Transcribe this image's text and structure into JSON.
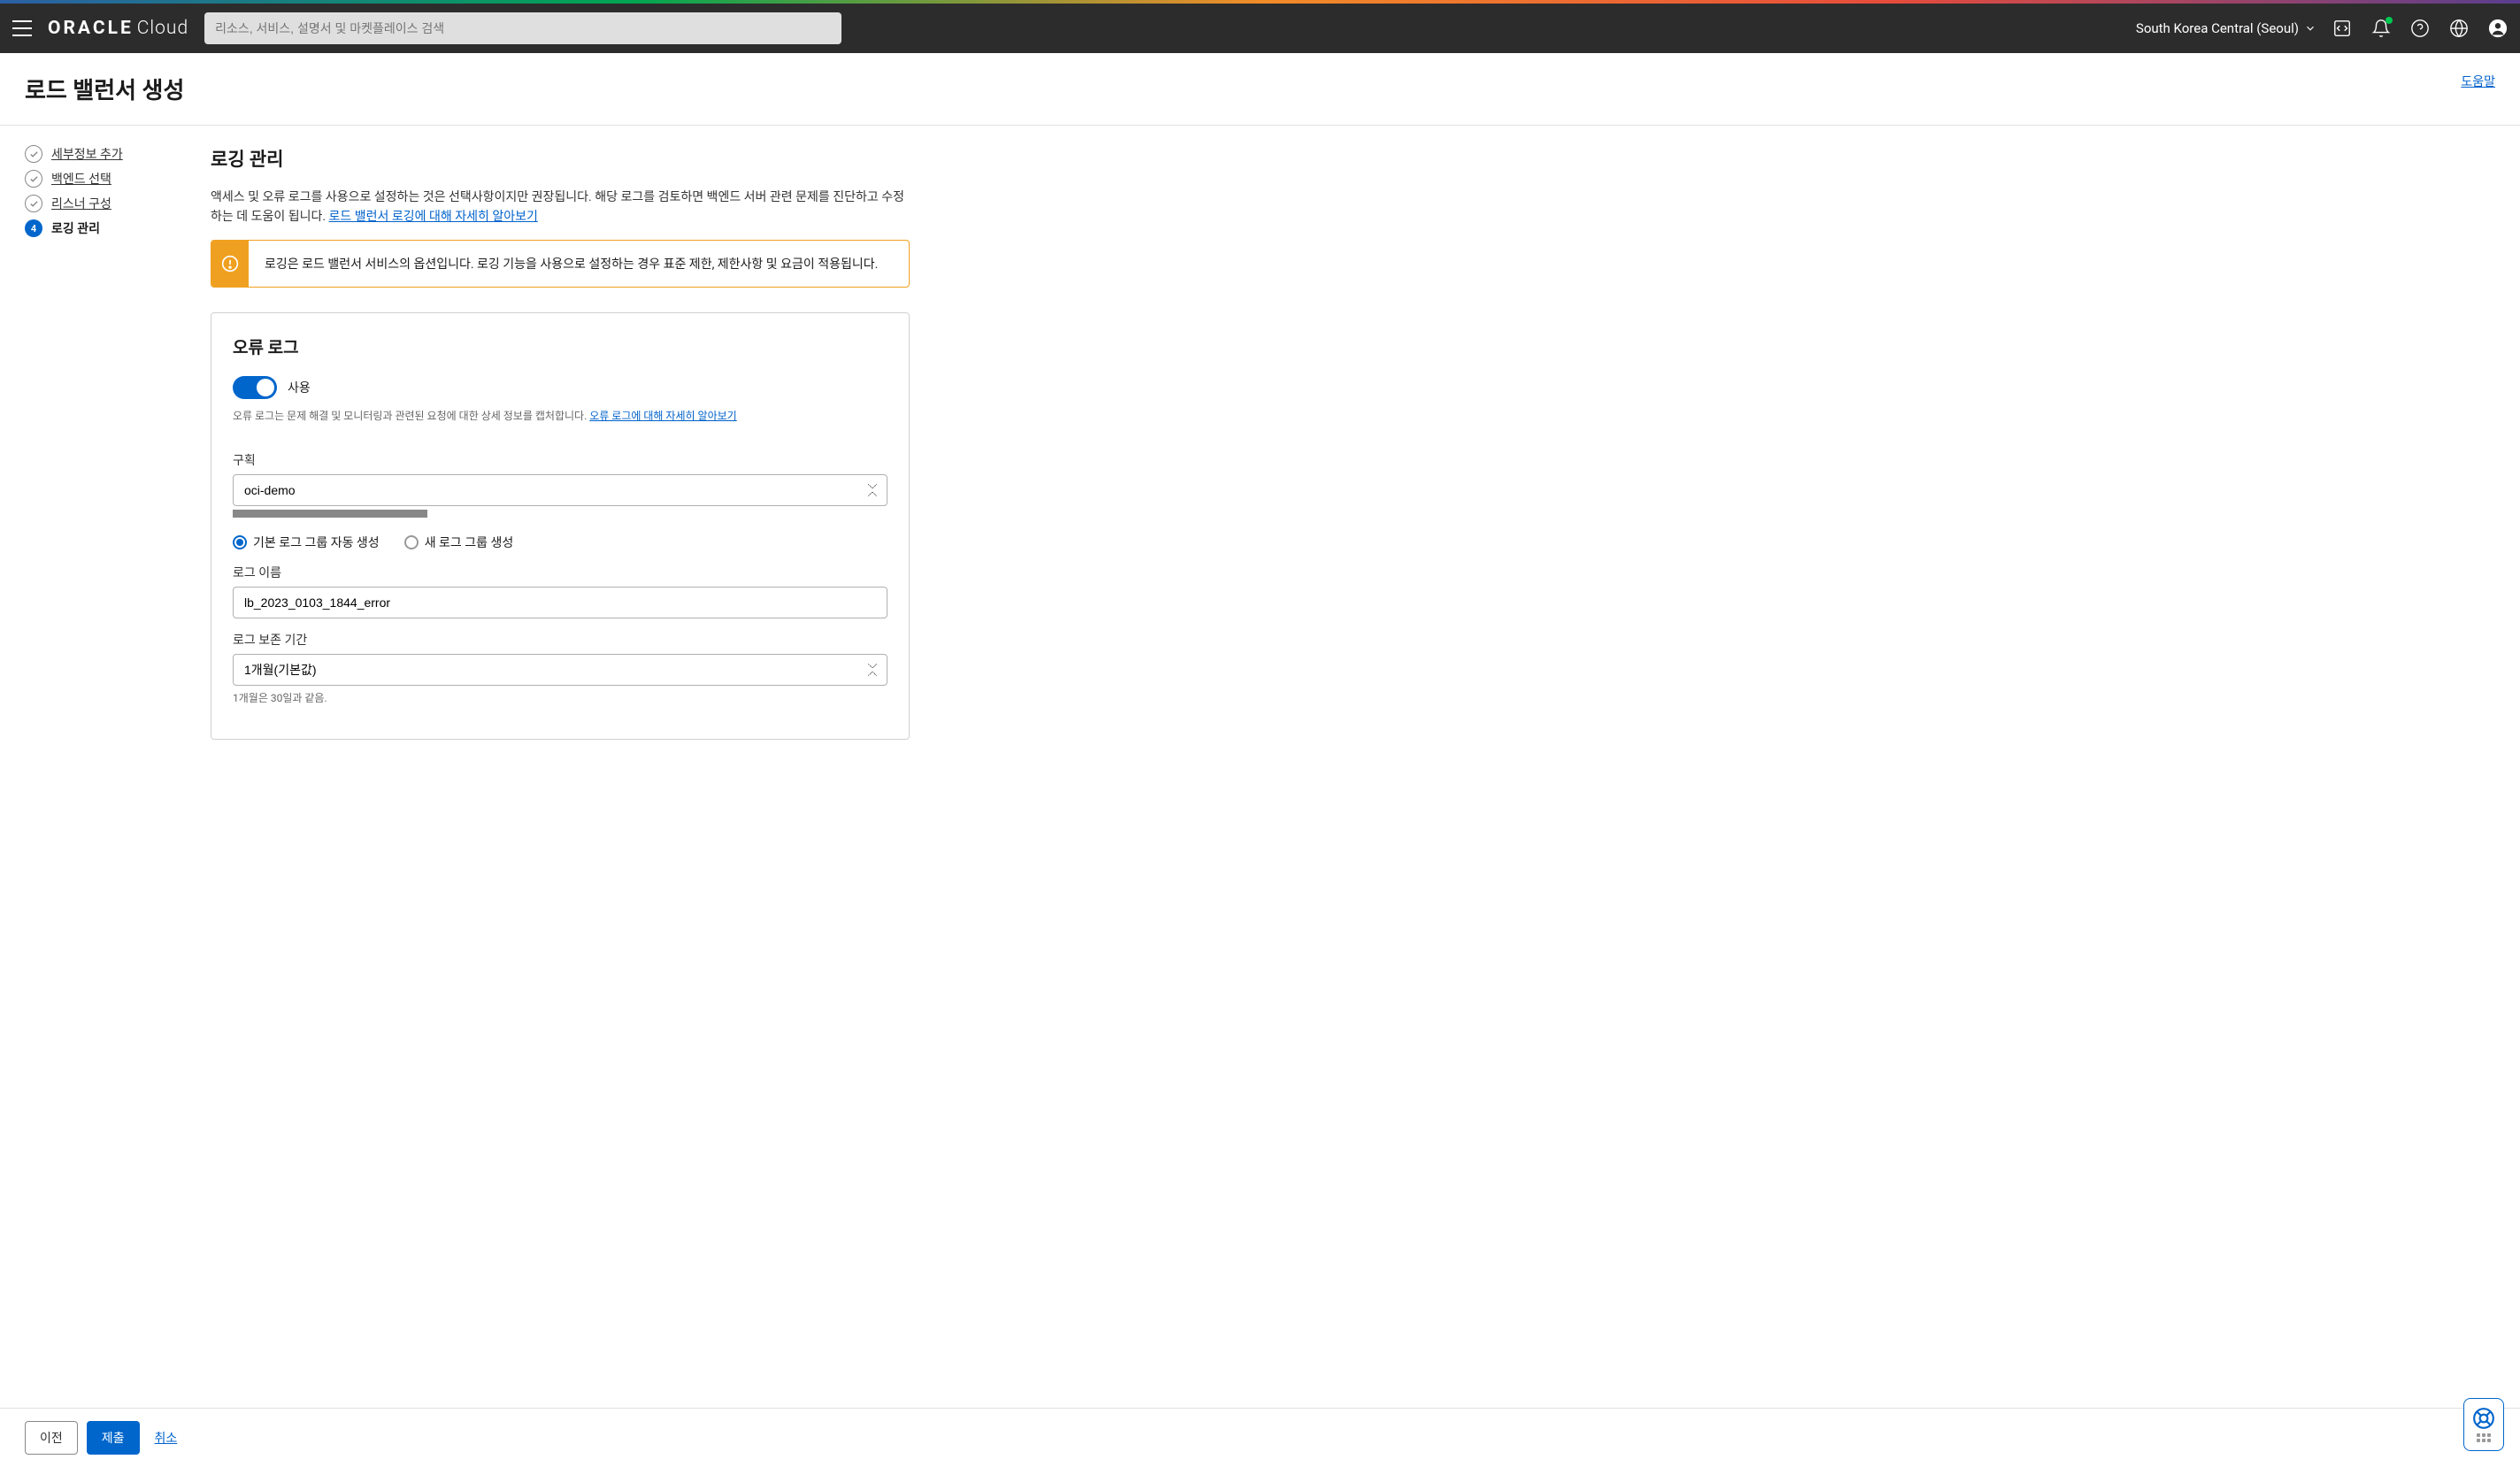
{
  "topnav": {
    "logo_bold": "ORACLE",
    "logo_light": "Cloud",
    "search_placeholder": "리소스, 서비스, 설명서 및 마켓플레이스 검색",
    "region": "South Korea Central (Seoul)"
  },
  "page": {
    "title": "로드 밸런서 생성",
    "help": "도움말"
  },
  "wizard": {
    "steps": [
      {
        "label": "세부정보 추가",
        "done": true
      },
      {
        "label": "백엔드 선택",
        "done": true
      },
      {
        "label": "리스너 구성",
        "done": true
      },
      {
        "label": "로깅 관리",
        "current": true,
        "number": "4"
      }
    ]
  },
  "content": {
    "section_title": "로깅 관리",
    "desc_text": "액세스 및 오류 로그를 사용으로 설정하는 것은 선택사항이지만 권장됩니다. 해당 로그를 검토하면 백엔드 서버 관련 문제를 진단하고 수정하는 데 도움이 됩니다. ",
    "desc_link": "로드 밸런서 로깅에 대해 자세히 알아보기",
    "alert_text": "로깅은 로드 밸런서 서비스의 옵션입니다. 로깅 기능을 사용으로 설정하는 경우 표준 제한, 제한사항 및 요금이 적용됩니다.",
    "card": {
      "title": "오류 로그",
      "toggle_label": "사용",
      "help_text": "오류 로그는 문제 해결 및 모니터링과 관련된 요청에 대한 상세 정보를 캡처합니다. ",
      "help_link": "오류 로그에 대해 자세히 알아보기",
      "compartment_label": "구획",
      "compartment_value": "oci-demo",
      "radio_auto": "기본 로그 그룹 자동 생성",
      "radio_new": "새 로그 그룹 생성",
      "logname_label": "로그 이름",
      "logname_value": "lb_2023_0103_1844_error",
      "retention_label": "로그 보존 기간",
      "retention_value": "1개월(기본값)",
      "retention_hint": "1개월은 30일과 같음."
    }
  },
  "footer": {
    "prev": "이전",
    "submit": "제출",
    "cancel": "취소"
  }
}
